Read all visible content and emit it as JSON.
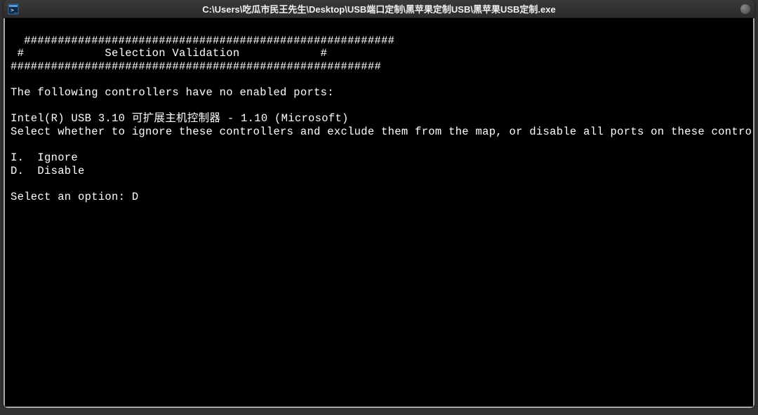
{
  "window": {
    "title": "C:\\Users\\吃瓜市民王先生\\Desktop\\USB端口定制\\黑苹果定制USB\\黑苹果USB定制.exe"
  },
  "terminal": {
    "header_line1": "  #######################################################",
    "header_line2": " #            Selection Validation            #",
    "header_line3": "#######################################################",
    "blank": "",
    "msg_no_ports": "The following controllers have no enabled ports:",
    "controller": "Intel(R) USB 3.10 可扩展主机控制器 - 1.10 (Microsoft)",
    "instruction": "Select whether to ignore these controllers and exclude them from the map, or disable all ports on these controllers.",
    "option_ignore": "I.  Ignore",
    "option_disable": "D.  Disable",
    "prompt_label": "Select an option: ",
    "prompt_value": "D"
  }
}
